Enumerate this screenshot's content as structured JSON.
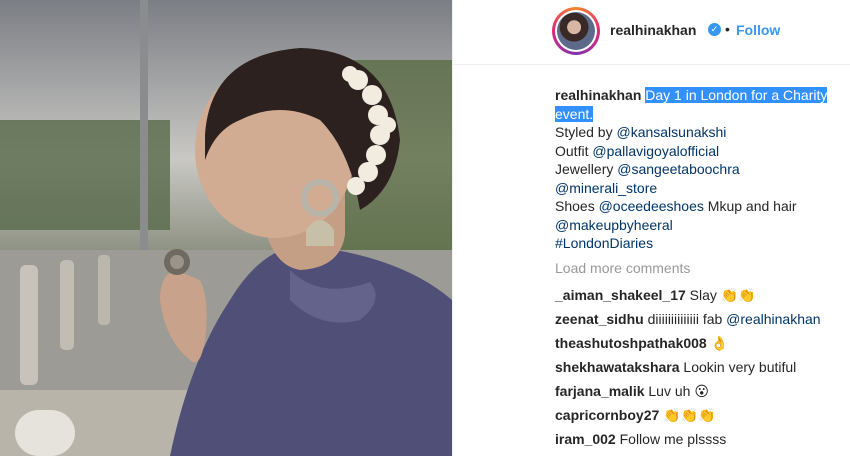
{
  "post": {
    "username": "realhinakhan",
    "verified_mark": "✓",
    "separator": "•",
    "follow_label": "Follow"
  },
  "caption": {
    "user": "realhinakhan",
    "highlighted_text": "Day 1 in London for a Charity event.",
    "lines": [
      {
        "prefix": "Styled by ",
        "mention": "@kansalsunakshi",
        "suffix": ""
      },
      {
        "prefix": "Outfit ",
        "mention": "@pallavigoyalofficial",
        "suffix": ""
      },
      {
        "prefix": "Jewellery ",
        "mention": "@sangeetaboochra",
        "suffix": ""
      },
      {
        "prefix": "",
        "mention": "@minerali_store",
        "suffix": ""
      },
      {
        "prefix": "Shoes ",
        "mention": "@oceedeeshoes",
        "suffix": " Mkup and hair"
      },
      {
        "prefix": "",
        "mention": "@makeupbyheeral",
        "suffix": ""
      },
      {
        "prefix": "",
        "mention": "#LondonDiaries",
        "suffix": ""
      }
    ]
  },
  "load_more": "Load more comments",
  "comments": [
    {
      "user": "_aiman_shakeel_17",
      "text": "Slay ",
      "emoji": "👏👏",
      "mention": ""
    },
    {
      "user": "zeenat_sidhu",
      "text": "diiiiiiiiiiiiii fab ",
      "emoji": "",
      "mention": "@realhinakhan"
    },
    {
      "user": "theashutoshpathak008",
      "text": "",
      "emoji": "👌",
      "mention": ""
    },
    {
      "user": "shekhawatakshara",
      "text": "Lookin very butiful",
      "emoji": "",
      "mention": ""
    },
    {
      "user": "farjana_malik",
      "text": "Luv uh ",
      "emoji": "😮",
      "mention": ""
    },
    {
      "user": "capricornboy27",
      "text": "",
      "emoji": "👏👏👏",
      "mention": ""
    },
    {
      "user": "iram_002",
      "text": "Follow me plssss",
      "emoji": "",
      "mention": ""
    }
  ],
  "icons": {
    "verified": "verified-badge-icon",
    "avatar": "profile-avatar"
  },
  "colors": {
    "link": "#3897f0",
    "highlight": "#3390ff",
    "mention": "#003569",
    "muted": "#999999"
  }
}
